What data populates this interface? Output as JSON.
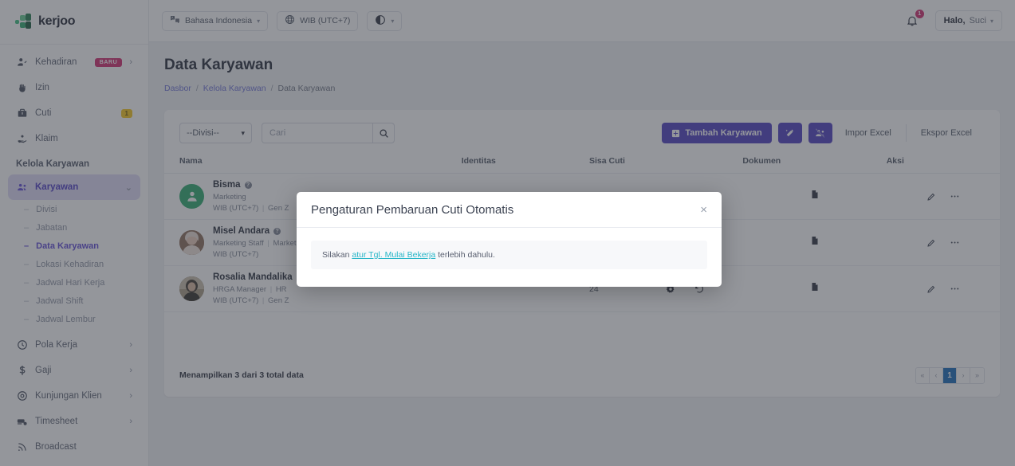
{
  "brand": {
    "name": "kerjoo",
    "accent": "#4b3bbf",
    "green": "#28a96a"
  },
  "sidebar": {
    "items": [
      {
        "label": "Kehadiran",
        "icon": "user-check-icon",
        "badge": "BARU",
        "chevron": "›"
      },
      {
        "label": "Izin",
        "icon": "hand-icon"
      },
      {
        "label": "Cuti",
        "icon": "briefcase-icon",
        "count": "1"
      },
      {
        "label": "Klaim",
        "icon": "hand-coin-icon"
      }
    ],
    "section_title": "Kelola Karyawan",
    "active_item": {
      "label": "Karyawan",
      "icon": "users-icon",
      "chevron": "⌄"
    },
    "sub_items": [
      {
        "label": "Divisi",
        "active": false
      },
      {
        "label": "Jabatan",
        "active": false
      },
      {
        "label": "Data Karyawan",
        "active": true
      },
      {
        "label": "Lokasi Kehadiran",
        "active": false
      },
      {
        "label": "Jadwal Hari Kerja",
        "active": false
      },
      {
        "label": "Jadwal Shift",
        "active": false
      },
      {
        "label": "Jadwal Lembur",
        "active": false
      }
    ],
    "groups": [
      {
        "label": "Pola Kerja",
        "icon": "clock-icon",
        "chevron": "›"
      },
      {
        "label": "Gaji",
        "icon": "dollar-icon",
        "chevron": "›"
      },
      {
        "label": "Kunjungan Klien",
        "icon": "map-pin-icon",
        "chevron": "›"
      },
      {
        "label": "Timesheet",
        "icon": "timesheet-icon",
        "chevron": "›"
      },
      {
        "label": "Broadcast",
        "icon": "broadcast-icon"
      }
    ]
  },
  "topbar": {
    "language": "Bahasa Indonesia",
    "timezone": "WIB (UTC+7)",
    "theme_label": "",
    "notification_count": "1",
    "greeting": "Halo,",
    "user_name": "Suci",
    "chevron": "⌄"
  },
  "page": {
    "title": "Data Karyawan",
    "breadcrumb": [
      {
        "label": "Dasbor",
        "link": true
      },
      {
        "label": "Kelola Karyawan",
        "link": true
      },
      {
        "label": "Data Karyawan",
        "link": false
      }
    ],
    "separator": "/"
  },
  "toolbar": {
    "division_select": "--Divisi--",
    "search_placeholder": "Cari",
    "search_value": "",
    "add_button": "Tambah Karyawan",
    "add_icon": "plus-square-icon",
    "magic_button_icon": "magic-wand-icon",
    "bulk_button_icon": "users-slash-icon",
    "import_button": "Impor Excel",
    "export_button": "Ekspor Excel"
  },
  "table": {
    "columns": [
      "Nama",
      "Identitas",
      "Sisa Cuti",
      "Dokumen",
      "Aksi"
    ],
    "rows": [
      {
        "name": "Bisma",
        "role_line": "Marketing",
        "meta_line": "WIB (UTC+7)",
        "meta_extra": "Gen Z",
        "identitas": "",
        "sisa_cuti": "",
        "avatar_type": "placeholder",
        "avatar_color": "#28a96a",
        "doc_icon": "document-icon",
        "edit_icon": "pencil-icon",
        "more_icon": "ellipsis-icon"
      },
      {
        "name": "Misel Andara",
        "role_line": "Marketing Staff",
        "role_extra": "Marketing",
        "meta_line": "WIB (UTC+7)",
        "meta_extra": "",
        "identitas": "",
        "sisa_cuti": "",
        "avatar_type": "photo",
        "avatar_color": "#8d6b57",
        "doc_icon": "document-icon",
        "edit_icon": "pencil-icon",
        "more_icon": "ellipsis-icon"
      },
      {
        "name": "Rosalia Mandalika",
        "role_line": "HRGA Manager",
        "role_extra": "HR",
        "meta_line": "WIB (UTC+7)",
        "meta_extra": "Gen Z",
        "identitas": "",
        "sisa_cuti": "24",
        "avatar_type": "photo",
        "avatar_color": "#4a4238",
        "doc_icon": "document-icon",
        "settings_icon": "gear-icon",
        "history_icon": "history-icon",
        "edit_icon": "pencil-icon",
        "more_icon": "ellipsis-icon"
      }
    ]
  },
  "footer": {
    "summary": "Menampilkan 3 dari 3 total data",
    "pagination": {
      "first": "«",
      "prev": "‹",
      "current": "1",
      "next": "›",
      "last": "»"
    }
  },
  "modal": {
    "title": "Pengaturan Pembaruan Cuti Otomatis",
    "close_icon": "×",
    "alert_prefix": "Silakan ",
    "alert_link": "atur Tgl. Mulai Bekerja",
    "alert_suffix": " terlebih dahulu.",
    "link_color": "#29b6c8"
  }
}
